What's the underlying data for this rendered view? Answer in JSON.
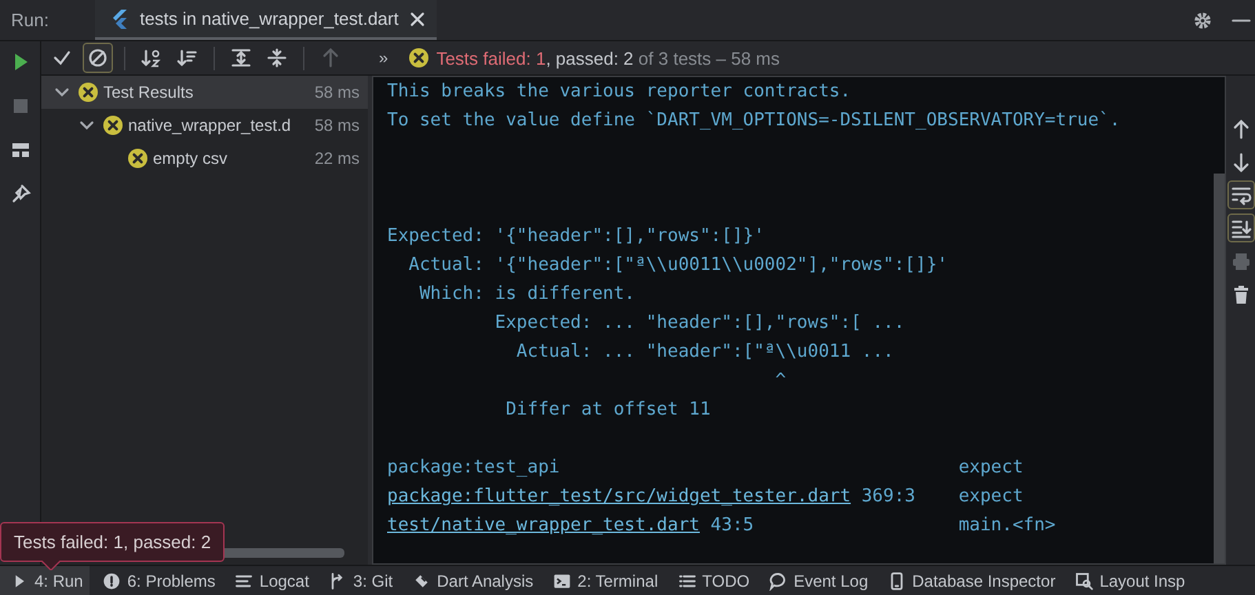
{
  "run_bar": {
    "label": "Run:",
    "tab": {
      "title": "tests in native_wrapper_test.dart",
      "selected": true
    }
  },
  "side_actions": [
    {
      "kind": "rerun",
      "disabled": false
    },
    {
      "kind": "stop",
      "disabled": true
    },
    {
      "kind": "layout",
      "disabled": false
    },
    {
      "kind": "pin",
      "disabled": false
    }
  ],
  "toolbar": {
    "groups": [
      [
        {
          "kind": "show-passed",
          "on": false,
          "disabled": false
        },
        {
          "kind": "show-ignored",
          "on": true,
          "disabled": false
        }
      ],
      [
        {
          "kind": "sort-alpha",
          "on": false,
          "disabled": false
        },
        {
          "kind": "sort-duration",
          "on": false,
          "disabled": false
        }
      ],
      [
        {
          "kind": "expand-all",
          "on": false,
          "disabled": false
        },
        {
          "kind": "collapse-all",
          "on": false,
          "disabled": false
        }
      ],
      [
        {
          "kind": "previous",
          "on": false,
          "disabled": true
        }
      ]
    ],
    "more": "»",
    "summary": {
      "kind": "failed",
      "failed": "Tests failed: 1",
      "passed": ", passed: 2",
      "total": "of 3 tests – 58 ms"
    }
  },
  "tree": [
    {
      "name": "Test Results",
      "time": "58 ms",
      "kind": "failed",
      "expanded": true,
      "selected": true,
      "children": [
        {
          "name": "native_wrapper_test.d",
          "time": "58 ms",
          "kind": "failed",
          "expanded": true,
          "selected": false,
          "children": [
            {
              "name": "empty csv",
              "time": "22 ms",
              "kind": "failed",
              "selected": false
            }
          ]
        }
      ]
    }
  ],
  "console": {
    "blocks": [
      {
        "kind": "output",
        "lines": [
          "This breaks the various reporter contracts.",
          "To set the value define `DART_VM_OPTIONS=-DSILENT_OBSERVATORY=true`."
        ]
      },
      {
        "kind": "diff",
        "lines": [
          "Expected: '{\"header\":[],\"rows\":[]}'",
          "  Actual: '{\"header\":[\"ª\\\\u0011\\\\u0002\"],\"rows\":[]}'",
          "   Which: is different.",
          "          Expected: ... \"header\":[],\"rows\":[ ...",
          "            Actual: ... \"header\":[\"ª\\\\u0011 ...",
          "                                    ^",
          "           Differ at offset 11"
        ]
      }
    ],
    "stack": [
      {
        "location": "package:test_api",
        "link": false,
        "function": "expect"
      },
      {
        "location": "package:flutter_test/src/widget_tester.dart",
        "link": true,
        "position": "369:3",
        "function": "expect"
      },
      {
        "location": "test/native_wrapper_test.dart",
        "link": true,
        "position": "43:5",
        "function": "main.<fn>"
      }
    ]
  },
  "right_actions": [
    {
      "kind": "up",
      "on": false,
      "disabled": false
    },
    {
      "kind": "down",
      "on": false,
      "disabled": false
    },
    {
      "kind": "soft-wrap",
      "on": true,
      "disabled": false
    },
    {
      "kind": "scroll-end",
      "on": true,
      "disabled": false
    },
    {
      "kind": "print",
      "on": false,
      "disabled": true
    },
    {
      "kind": "delete",
      "on": false,
      "disabled": false
    }
  ],
  "tool_windows": [
    {
      "kind": "run",
      "label": "4: Run",
      "selected": true
    },
    {
      "kind": "problems",
      "label": "6: Problems",
      "selected": false
    },
    {
      "kind": "logcat",
      "label": "Logcat",
      "selected": false
    },
    {
      "kind": "git",
      "label": "3: Git",
      "selected": false
    },
    {
      "kind": "analysis",
      "label": "Dart Analysis",
      "selected": false
    },
    {
      "kind": "terminal",
      "label": "2: Terminal",
      "selected": false
    },
    {
      "kind": "todo",
      "label": "TODO",
      "selected": false
    },
    {
      "kind": "event-log",
      "label": "Event Log",
      "selected": false
    },
    {
      "kind": "database",
      "label": "Database Inspector",
      "selected": false
    },
    {
      "kind": "layout",
      "label": "Layout Insp",
      "selected": false
    }
  ],
  "tooltip": "Tests failed: 1, passed: 2"
}
